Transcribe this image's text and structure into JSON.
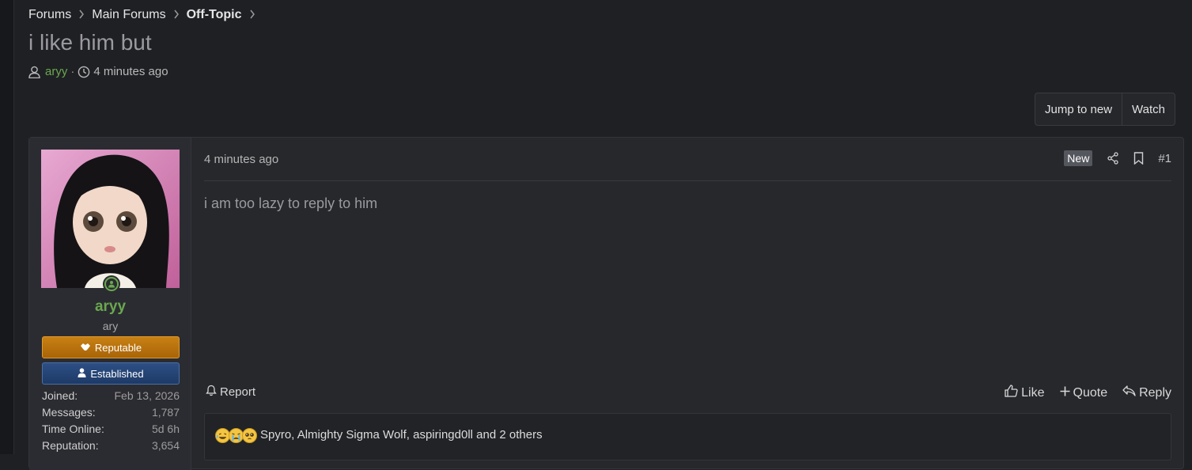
{
  "breadcrumb": [
    {
      "label": "Forums"
    },
    {
      "label": "Main Forums"
    },
    {
      "label": "Off-Topic"
    }
  ],
  "thread": {
    "title": "i like him but",
    "author": "aryy",
    "separator": "·",
    "time": "4 minutes ago"
  },
  "toolbar": {
    "jump_label": "Jump to new",
    "watch_label": "Watch"
  },
  "post": {
    "time": "4 minutes ago",
    "new_badge": "New",
    "number": "#1",
    "message": "i am too lazy to reply to him",
    "report_label": "Report",
    "like_label": "Like",
    "quote_label": "Quote",
    "reply_label": "Reply",
    "reactions_text": "Spyro, Almighty Sigma Wolf, aspiringd0ll and 2 others",
    "reaction_icons": [
      "laughing-emoji",
      "crying-emoji",
      "pleading-emoji"
    ]
  },
  "user": {
    "name": "aryy",
    "title": "ary",
    "banners": {
      "reputable": "Reputable",
      "established": "Established"
    },
    "stats": [
      {
        "label": "Joined:",
        "value": "Feb 13, 2026"
      },
      {
        "label": "Messages:",
        "value": "1,787"
      },
      {
        "label": "Time Online:",
        "value": "5d 6h"
      },
      {
        "label": "Reputation:",
        "value": "3,654"
      }
    ]
  },
  "colors": {
    "background": "#1f2024",
    "username": "#6aa84f",
    "reputable_banner": "#c88113",
    "established_banner": "#2d4f85"
  }
}
